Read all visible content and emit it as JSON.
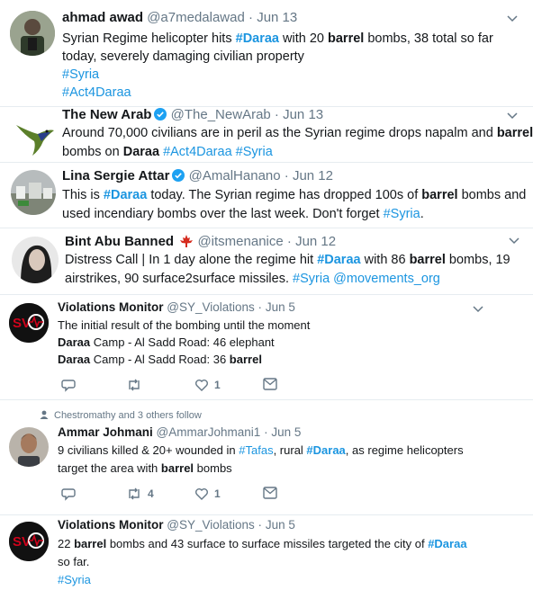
{
  "tweets": [
    {
      "name": "ahmad awad",
      "handle": "@a7medalawad",
      "date": "Jun 13",
      "lines": [
        [
          [
            "t",
            "Syrian Regime helicopter hits "
          ],
          [
            "h",
            "#Daraa"
          ],
          [
            "t",
            " with 20 "
          ],
          [
            "b",
            "barrel"
          ],
          [
            "t",
            " bombs, 38 total so far"
          ]
        ],
        [
          [
            "t",
            "today, severely damaging civilian property"
          ]
        ],
        [
          [
            "l",
            "#Syria"
          ]
        ],
        [
          [
            "l",
            "#Act4Daraa"
          ]
        ]
      ]
    },
    {
      "name": "The New Arab",
      "handle": "@The_NewArab",
      "date": "Jun 13",
      "lines": [
        [
          [
            "t",
            "Around 70,000 civilians are in peril as the Syrian regime drops napalm and "
          ],
          [
            "b",
            "barrel"
          ]
        ],
        [
          [
            "t",
            "bombs on "
          ],
          [
            "b",
            "Daraa"
          ],
          [
            "t",
            " "
          ],
          [
            "l",
            "#Act4Daraa"
          ],
          [
            "t",
            " "
          ],
          [
            "l",
            "#Syria"
          ]
        ]
      ]
    },
    {
      "name": "Lina Sergie Attar",
      "handle": "@AmalHanano",
      "date": "Jun 12",
      "lines": [
        [
          [
            "t",
            "This is "
          ],
          [
            "h",
            "#Daraa"
          ],
          [
            "t",
            " today. The Syrian regime has dropped 100s of "
          ],
          [
            "b",
            "barrel"
          ],
          [
            "t",
            " bombs and"
          ]
        ],
        [
          [
            "t",
            "used incendiary bombs over the last week. Don't forget "
          ],
          [
            "l",
            "#Syria"
          ],
          [
            "t",
            "."
          ]
        ]
      ]
    },
    {
      "name": "Bint Abu Banned",
      "handle": "@itsmenanice",
      "date": "Jun 12",
      "lines": [
        [
          [
            "t",
            "Distress Call | In 1 day alone the regime hit "
          ],
          [
            "h",
            "#Daraa"
          ],
          [
            "t",
            " with 86 "
          ],
          [
            "b",
            "barrel"
          ],
          [
            "t",
            " bombs, 19"
          ]
        ],
        [
          [
            "t",
            "airstrikes, 90 surface2surface missiles. "
          ],
          [
            "l",
            "#Syria"
          ],
          [
            "t",
            " "
          ],
          [
            "l",
            "@movements_org"
          ]
        ]
      ]
    },
    {
      "name": "Violations Monitor",
      "handle": "@SY_Violations",
      "date": "Jun 5",
      "avatar_text": "SV",
      "lines": [
        [
          [
            "t",
            "The initial result of the bombing until the moment"
          ]
        ],
        [
          [
            "b",
            "Daraa"
          ],
          [
            "t",
            " Camp - Al Sadd Road: 46 elephant"
          ]
        ],
        [
          [
            "b",
            "Daraa"
          ],
          [
            "t",
            " Camp - Al Sadd Road: 36 "
          ],
          [
            "b",
            "barrel"
          ]
        ]
      ],
      "actions": {
        "retweets": "",
        "likes": "1"
      }
    },
    {
      "social_context": "Chestromathy and 3 others follow",
      "name": "Ammar Johmani",
      "handle": "@AmmarJohmani1",
      "date": "Jun 5",
      "lines": [
        [
          [
            "t",
            "9 civilians killed & 20+ wounded in "
          ],
          [
            "l",
            "#Tafas"
          ],
          [
            "t",
            ", rural "
          ],
          [
            "h",
            "#Daraa"
          ],
          [
            "t",
            ", as regime helicopters"
          ]
        ],
        [
          [
            "t",
            "target the area with "
          ],
          [
            "b",
            "barrel"
          ],
          [
            "t",
            " bombs"
          ]
        ]
      ],
      "actions": {
        "retweets": "4",
        "likes": "1"
      }
    },
    {
      "name": "Violations Monitor",
      "handle": "@SY_Violations",
      "date": "Jun 5",
      "avatar_text": "SV",
      "lines": [
        [
          [
            "t",
            "22 "
          ],
          [
            "b",
            "barrel"
          ],
          [
            "t",
            " bombs and 43 surface to surface missiles targeted the city of "
          ],
          [
            "h",
            "#Daraa"
          ]
        ],
        [
          [
            "t",
            "so far."
          ]
        ],
        [
          [
            "l",
            "#Syria"
          ]
        ]
      ]
    }
  ],
  "colors": {
    "link": "#1b95e0",
    "muted": "#657786",
    "verified": "#1da1f2",
    "monitor": "#d0021b"
  }
}
